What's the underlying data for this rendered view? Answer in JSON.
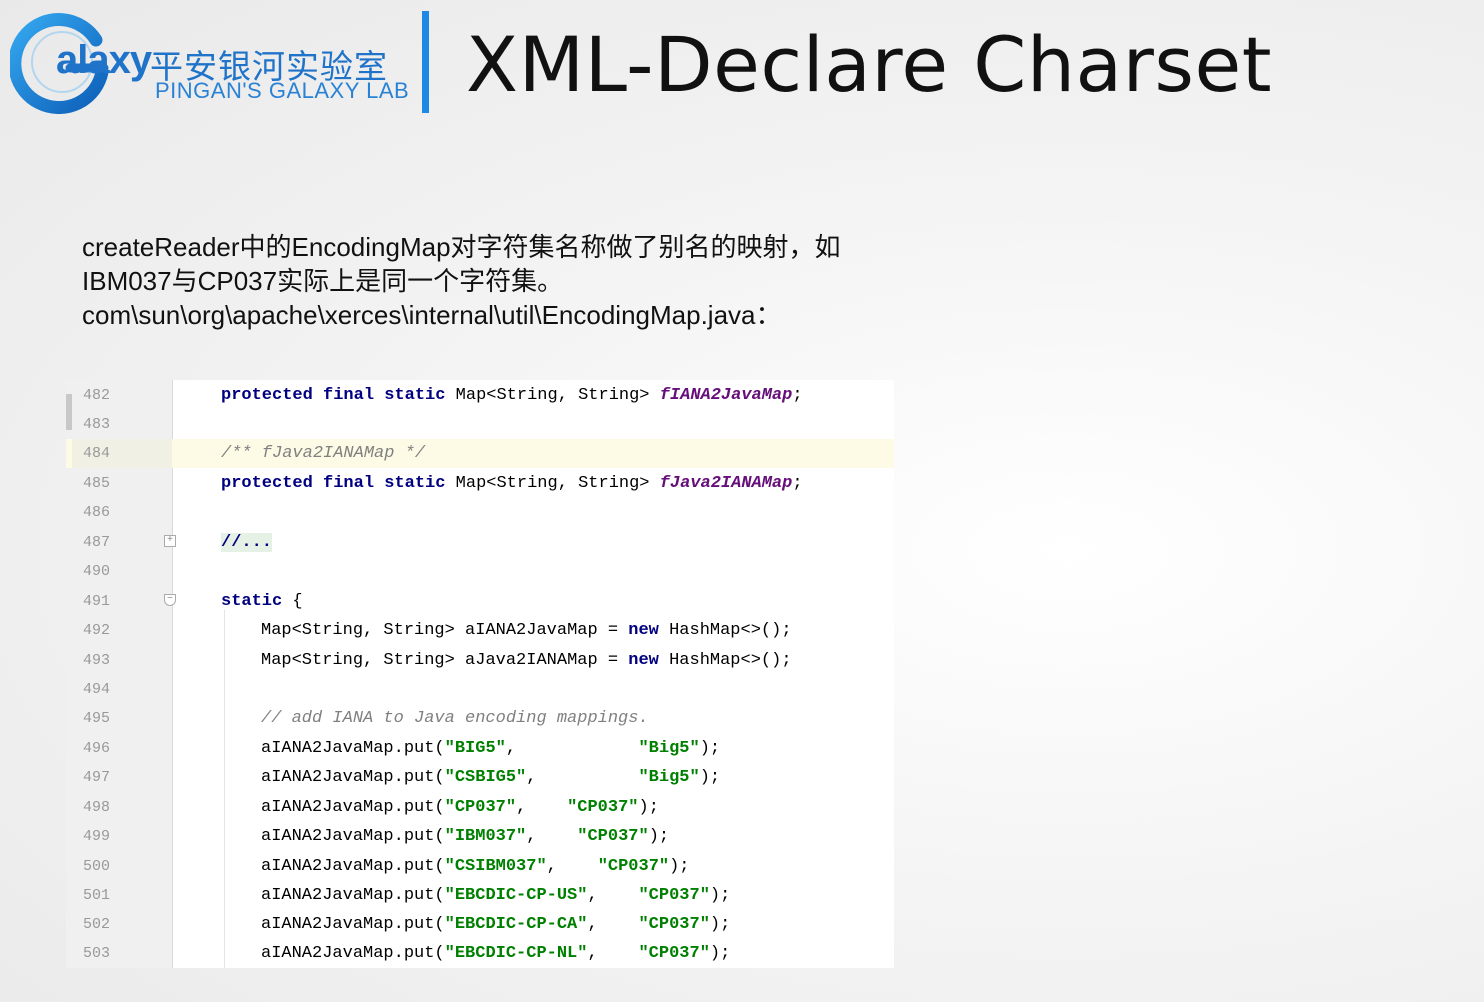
{
  "logo": {
    "wordmark": "alaxy",
    "name_cn": "平安银河实验室",
    "name_en": "PINGAN'S GALAXY LAB",
    "colors": {
      "primary": "#1f73c9",
      "accent": "#1e88e5"
    }
  },
  "title": "XML-Declare Charset",
  "description": [
    "createReader中的EncodingMap对字符集名称做了别名的映射，如",
    "IBM037与CP037实际上是同一个字符集。",
    "com\\sun\\org\\apache\\xerces\\internal\\util\\EncodingMap.java："
  ],
  "code": {
    "line_numbers": [
      "482",
      "483",
      "484",
      "485",
      "486",
      "487",
      "490",
      "491",
      "492",
      "493",
      "494",
      "495",
      "496",
      "497",
      "498",
      "499",
      "500",
      "501",
      "502",
      "503"
    ],
    "decl_keywords": [
      "protected",
      "final",
      "static"
    ],
    "map_type": "Map<String, String>",
    "field_1": "fIANA2JavaMap",
    "comment_doc": "/** fJava2IANAMap */",
    "field_2": "fJava2IANAMap",
    "folded": "//...",
    "static_kw": "static",
    "brace": "{",
    "local_1": "aIANA2JavaMap",
    "local_2": "aJava2IANAMap",
    "new_kw": "new",
    "ctor": "HashMap<>()",
    "comment_line": "// add IANA to Java encoding mappings.",
    "put_prefix": "aIANA2JavaMap.put(",
    "mappings": [
      {
        "iana": "\"BIG5\"",
        "sep": ",            ",
        "java": "\"Big5\""
      },
      {
        "iana": "\"CSBIG5\"",
        "sep": ",          ",
        "java": "\"Big5\""
      },
      {
        "iana": "\"CP037\"",
        "sep": ",    ",
        "java": "\"CP037\""
      },
      {
        "iana": "\"IBM037\"",
        "sep": ",    ",
        "java": "\"CP037\""
      },
      {
        "iana": "\"CSIBM037\"",
        "sep": ",    ",
        "java": "\"CP037\""
      },
      {
        "iana": "\"EBCDIC-CP-US\"",
        "sep": ",    ",
        "java": "\"CP037\""
      },
      {
        "iana": "\"EBCDIC-CP-CA\"",
        "sep": ",    ",
        "java": "\"CP037\""
      },
      {
        "iana": "\"EBCDIC-CP-NL\"",
        "sep": ",    ",
        "java": "\"CP037\""
      }
    ],
    "colors": {
      "keyword": "#000080",
      "field": "#660e7a",
      "comment": "#808080",
      "string": "#008000",
      "highlight_row": "#fdfbe6"
    }
  }
}
